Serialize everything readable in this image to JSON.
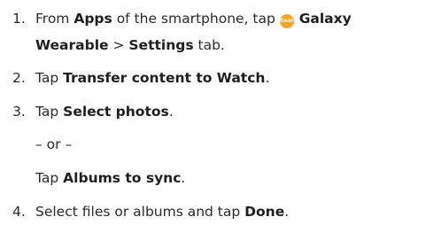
{
  "steps": [
    {
      "number": "1.",
      "line1": {
        "pre": "From ",
        "apps": "Apps",
        "mid": " of the smartphone, tap ",
        "icon_label": "Gear",
        "galaxy": "Galaxy"
      },
      "line2": {
        "wearable": "Wearable",
        "sep": " > ",
        "settings": "Settings",
        "post": " tab."
      }
    },
    {
      "number": "2.",
      "pre": "Tap ",
      "bold": "Transfer content to Watch",
      "post": "."
    },
    {
      "number": "3.",
      "pre": "Tap ",
      "bold": "Select photos",
      "post": "."
    },
    {
      "or": "– or –"
    },
    {
      "pre": "Tap ",
      "bold": "Albums to sync",
      "post": "."
    },
    {
      "number": "4.",
      "pre": "Select files or albums and tap ",
      "bold": "Done",
      "post": "."
    }
  ],
  "icons": {
    "gear_app_icon": "galaxy-wearable-app-icon",
    "gear_icon_color": "#f6a52a"
  }
}
